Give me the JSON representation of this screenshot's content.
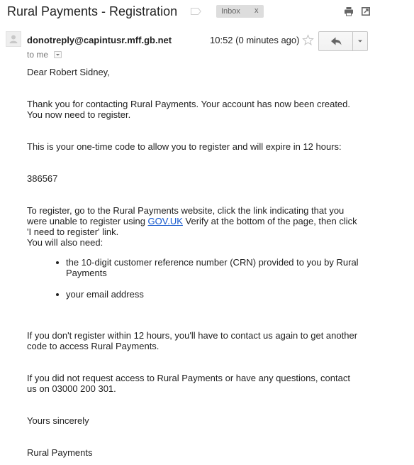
{
  "subject": "Rural Payments - Registration",
  "label": {
    "name": "Inbox",
    "remove": "x"
  },
  "icons": {
    "important": "important-marker-icon",
    "print": "printer-icon",
    "new_window": "open-in-new-window-icon",
    "avatar": "person-silhouette-icon",
    "star": "star-icon",
    "reply": "reply-arrow-icon",
    "more": "chevron-down-icon"
  },
  "colors": {
    "link": "#1155cc",
    "text": "#222222",
    "muted": "#777777",
    "label_bg": "#dddddd"
  },
  "message": {
    "sender": "donotreply@capintusr.mff.gb.net",
    "to": "to me",
    "time": "10:52 (0 minutes ago)",
    "greeting": "Dear Robert Sidney,",
    "para_created_1": "Thank you for contacting Rural Payments. Your account has now been created.",
    "para_created_2": "You now need to register.",
    "code_intro": "This is your one-time code to allow you to register and will expire in 12 hours:",
    "code": "386567",
    "register_before": "To register, go to the Rural Payments website, click the link indicating that you were unable to register using ",
    "register_link": "GOV.UK",
    "register_after": " Verify at the bottom of the page, then click 'I need to register' link.",
    "also_need": "You will also need:",
    "needs": [
      "the 10-digit customer reference number (CRN) provided to you by Rural Payments",
      "your email address"
    ],
    "expiry_note": "If you don't register within 12 hours, you'll have to contact us again to get another code to access Rural Payments.",
    "contact_note": "If you did not request access to Rural Payments or have any questions, contact us on 03000 200 301.",
    "closing": "Yours sincerely",
    "signature": "Rural Payments"
  }
}
